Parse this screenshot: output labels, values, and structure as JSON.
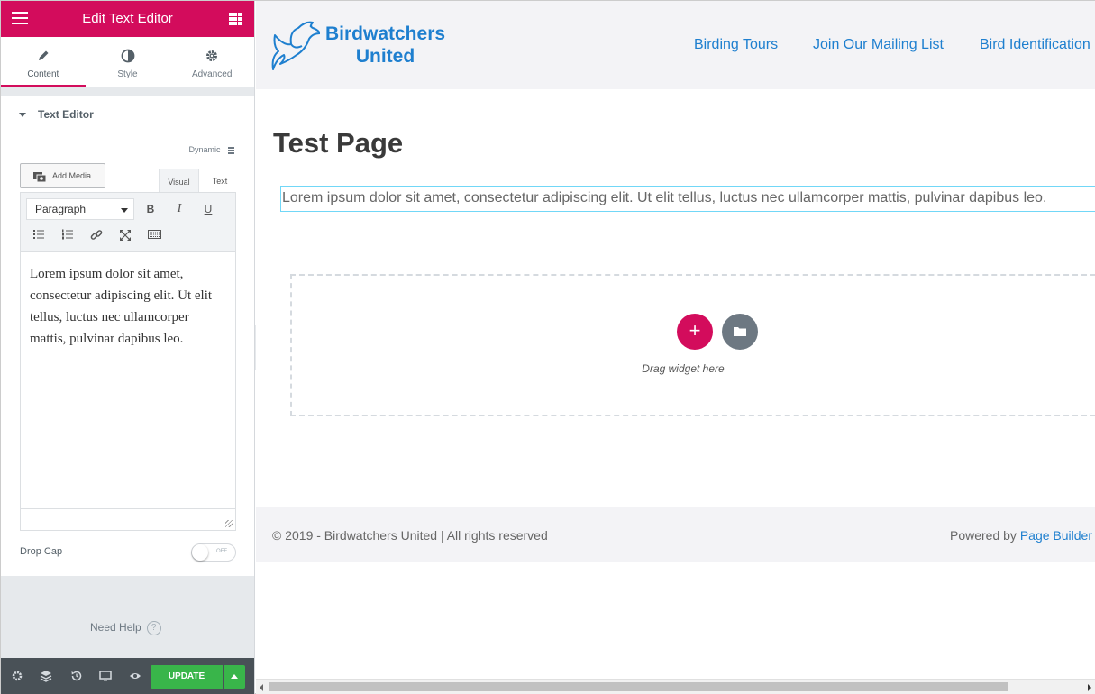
{
  "panel": {
    "title": "Edit Text Editor",
    "tabs": [
      {
        "label": "Content",
        "icon": "pencil-icon"
      },
      {
        "label": "Style",
        "icon": "half-circle-icon"
      },
      {
        "label": "Advanced",
        "icon": "gear-icon"
      }
    ],
    "section_title": "Text Editor",
    "dynamic_label": "Dynamic",
    "add_media_label": "Add Media",
    "editor_tabs": [
      "Visual",
      "Text"
    ],
    "format_select": "Paragraph",
    "format_buttons": [
      "B",
      "I",
      "U"
    ],
    "editor_content": "Lorem ipsum dolor sit amet, consectetur adipiscing elit. Ut elit tellus, luctus nec ullamcorper mattis, pulvinar dapibus leo.",
    "drop_cap_label": "Drop Cap",
    "drop_cap_state": "OFF",
    "need_help_label": "Need Help",
    "need_help_icon": "?",
    "update_label": "UPDATE",
    "accent_color": "#d30c5c",
    "update_color": "#39b54a"
  },
  "site": {
    "logo_line1": "Birdwatchers",
    "logo_line2": "United",
    "nav": [
      "Birding Tours",
      "Join Our Mailing List",
      "Bird Identification"
    ],
    "page_title": "Test Page",
    "body_text": "Lorem ipsum dolor sit amet, consectetur adipiscing elit. Ut elit tellus, luctus nec ullamcorper mattis, pulvinar dapibus leo.",
    "add_button": "+",
    "drag_text": "Drag widget here",
    "copyright": "© 2019 - Birdwatchers United | All rights reserved",
    "powered_prefix": "Powered by",
    "powered_link": "Page Builder",
    "link_color": "#1e7fcf"
  }
}
